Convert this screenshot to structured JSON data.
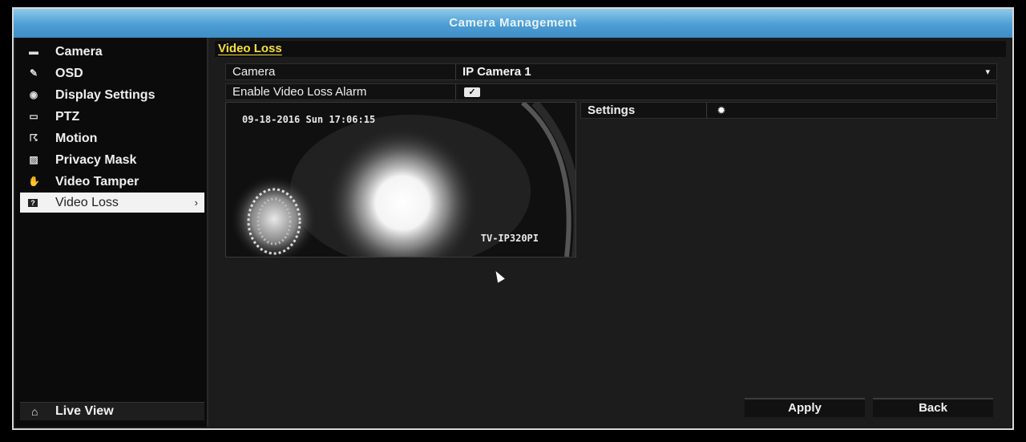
{
  "window": {
    "title": "Camera Management"
  },
  "sidebar": {
    "items": [
      {
        "label": "Camera",
        "icon": "camera-icon"
      },
      {
        "label": "OSD",
        "icon": "osd-icon"
      },
      {
        "label": "Display Settings",
        "icon": "display-settings-icon"
      },
      {
        "label": "PTZ",
        "icon": "ptz-icon"
      },
      {
        "label": "Motion",
        "icon": "motion-icon"
      },
      {
        "label": "Privacy Mask",
        "icon": "privacy-mask-icon"
      },
      {
        "label": "Video Tamper",
        "icon": "video-tamper-icon"
      },
      {
        "label": "Video Loss",
        "icon": "video-loss-icon",
        "active": true
      }
    ],
    "live_view": {
      "label": "Live View",
      "icon": "home-icon"
    }
  },
  "main": {
    "section_title": "Video Loss",
    "camera_label": "Camera",
    "camera_value": "IP Camera 1",
    "enable_label": "Enable Video Loss Alarm",
    "enable_checked": true,
    "preview": {
      "timestamp": "09-18-2016 Sun 17:06:15",
      "model": "TV-IP320PI"
    },
    "settings_label": "Settings",
    "settings_icon": "gear-icon"
  },
  "buttons": {
    "apply": "Apply",
    "back": "Back"
  },
  "colors": {
    "title_bar": "#4c9ed4",
    "section_title": "#f3e03a"
  }
}
